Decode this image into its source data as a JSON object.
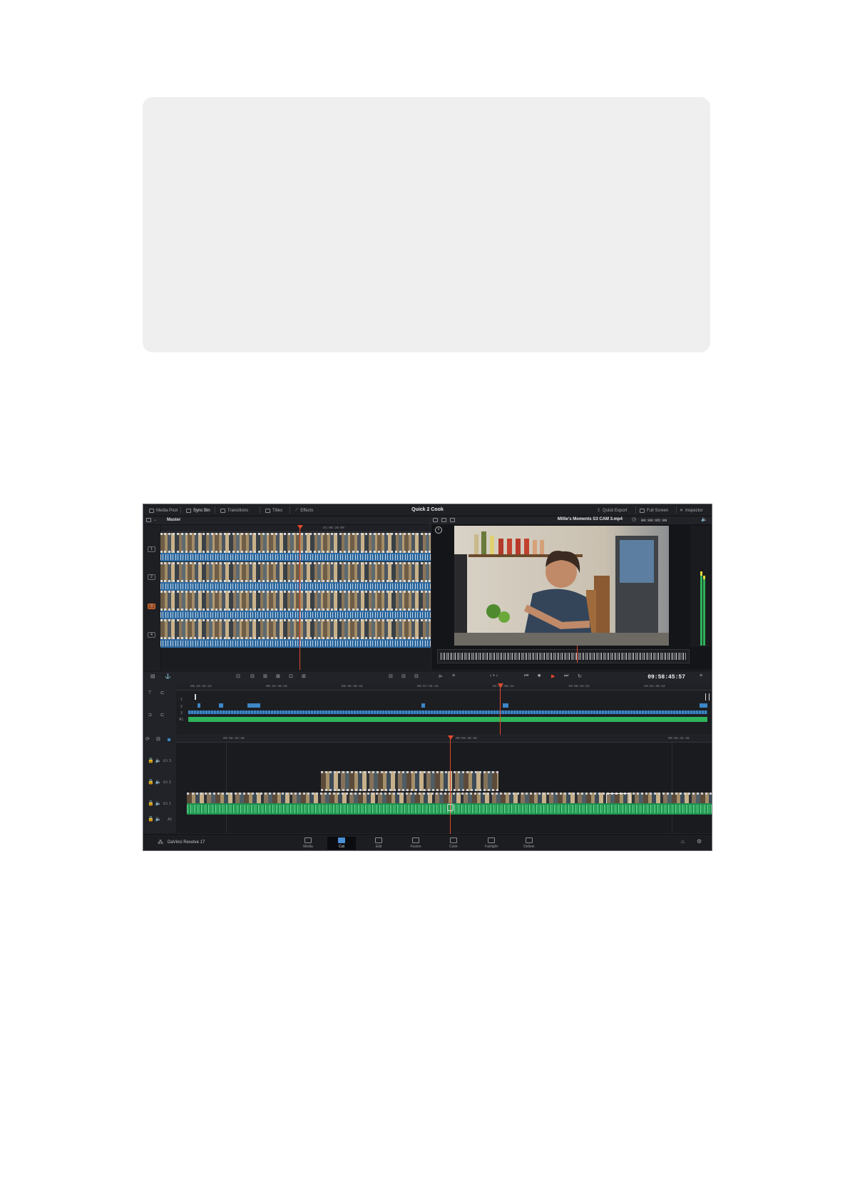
{
  "window": {
    "title": "Quick 2 Cook"
  },
  "toolbar": {
    "media_pool": "Media Pool",
    "sync_bin": "Sync Bin",
    "transitions": "Transitions",
    "titles": "Titles",
    "effects": "Effects",
    "quick_export": "Quick Export",
    "full_screen": "Full Screen",
    "inspector": "Inspector"
  },
  "source_tape": {
    "bin_name": "Master",
    "ruler_tc": "01:00:20:00",
    "tracks": [
      "1",
      "2",
      "3",
      "4"
    ]
  },
  "viewer": {
    "clip_name": "Millie's Moments S3 CAM 3.mp4",
    "duration": "00:00:05:09"
  },
  "transport": {
    "timecode": "09:58:45:57"
  },
  "upper_timeline": {
    "ruler": [
      "09:43:22:22",
      "09:44:46:28",
      "09:46:48:41",
      "09:57:54:44",
      "02:03:08:44",
      "10:06:22:22",
      "10:01:46:44"
    ],
    "track_numbers": [
      "1",
      "2",
      "3",
      "A1"
    ]
  },
  "lower_timeline": {
    "ruler": [
      "09:58:34:48",
      "09:58:38:48",
      "09:58:42:48"
    ],
    "tracks": [
      "3",
      "2",
      "1",
      "A1"
    ]
  },
  "app": {
    "name": "DaVinci Resolve 17"
  },
  "pages": [
    "Media",
    "Cut",
    "Edit",
    "Fusion",
    "Color",
    "Fairlight",
    "Deliver"
  ],
  "colors": {
    "accent_blue": "#3d86c6",
    "audio_green": "#2fb35b",
    "playhead_red": "#e3492f"
  }
}
